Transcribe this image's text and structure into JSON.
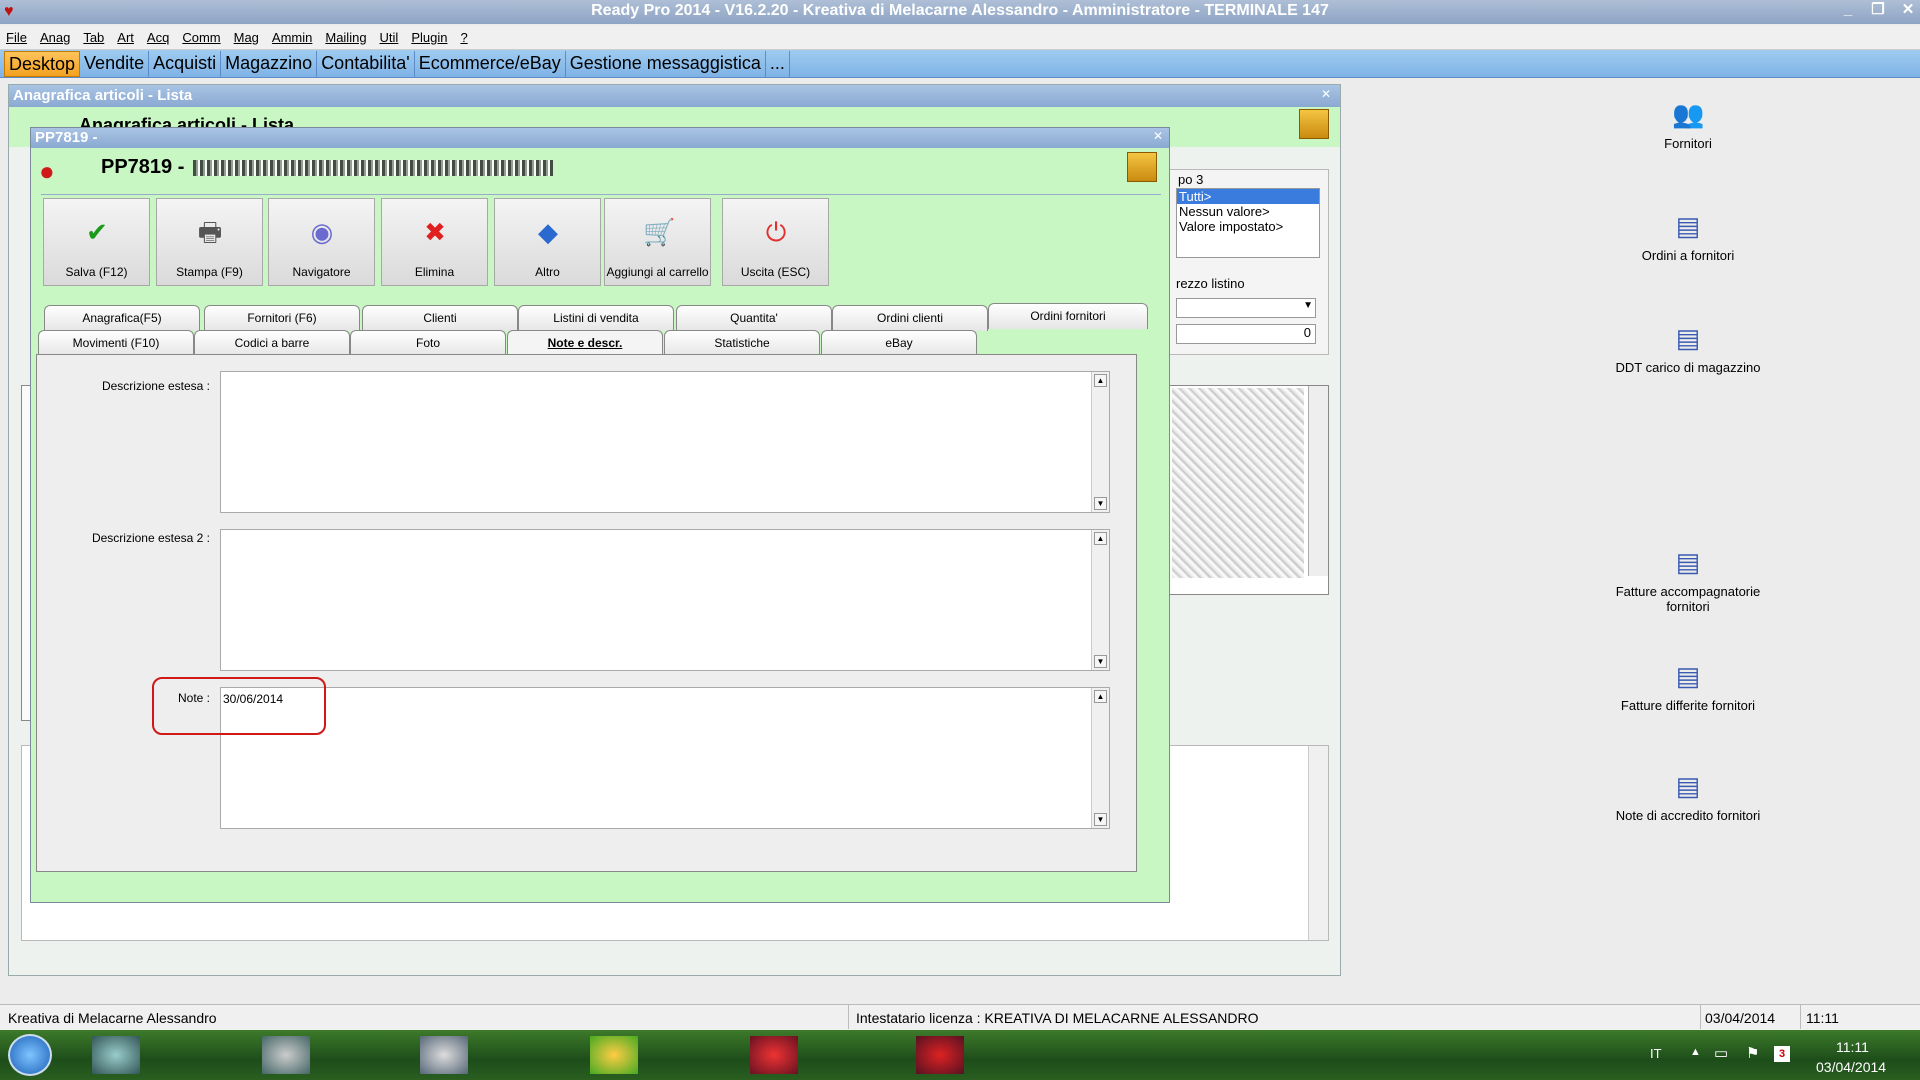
{
  "window": {
    "title": "Ready Pro 2014 - V16.2.20 - Kreativa di Melacarne Alessandro - Amministratore - TERMINALE 147",
    "minimize_icon": "minimize-icon",
    "restore_icon": "restore-icon",
    "close_icon": "close-icon"
  },
  "menu": [
    "File",
    "Anag",
    "Tab",
    "Art",
    "Acq",
    "Comm",
    "Mag",
    "Ammin",
    "Mailing",
    "Util",
    "Plugin",
    "?"
  ],
  "module_tabs": [
    "Desktop",
    "Vendite",
    "Acquisti",
    "Magazzino",
    "Contabilita'",
    "Ecommerce/eBay",
    "Gestione messaggistica",
    "..."
  ],
  "list_window": {
    "title": "Anagrafica articoli  - Lista",
    "subtitle": "Anagrafica articoli  - Lista",
    "filter_label": "po 3",
    "filter_options": [
      "Tutti>",
      "Nessun valore>",
      "Valore impostato>"
    ],
    "price_label": "rezzo listino",
    "price_value": "0"
  },
  "detail": {
    "header": "PP7819 -",
    "title": "PP7819 -",
    "buttons": [
      {
        "label": "Salva (F12)",
        "icon": "check-icon",
        "glyph": "✔",
        "color": "#1a9a1a"
      },
      {
        "label": "Stampa (F9)",
        "icon": "printer-icon",
        "glyph": "🖶",
        "color": "#555"
      },
      {
        "label": "Navigatore",
        "icon": "navigator-icon",
        "glyph": "◉",
        "color": "#6a6ad0"
      },
      {
        "label": "Elimina",
        "icon": "delete-icon",
        "glyph": "✖",
        "color": "#e02020"
      },
      {
        "label": "Altro",
        "icon": "book-icon",
        "glyph": "◆",
        "color": "#2a6ad0"
      },
      {
        "label": "Aggiungi al carrello",
        "icon": "cart-icon",
        "glyph": "🛒",
        "color": "#555"
      },
      {
        "label": "Uscita (ESC)",
        "icon": "exit-icon",
        "glyph": "⏻",
        "color": "#e03030"
      }
    ],
    "tabs_row1": [
      "Anagrafica(F5)",
      "Fornitori (F6)",
      "Clienti",
      "Listini di vendita",
      "Quantita'",
      "Ordini clienti",
      "Ordini fornitori"
    ],
    "tabs_row2": [
      "Movimenti (F10)",
      "Codici a barre",
      "Foto",
      "Note e descr.",
      "Statistiche",
      "eBay"
    ],
    "selected_tab": "Note e descr.",
    "fields": {
      "desc1_label": "Descrizione estesa :",
      "desc1_value": "",
      "desc2_label": "Descrizione estesa 2 :",
      "desc2_value": "",
      "note_label": "Note :",
      "note_value": "30/06/2014"
    }
  },
  "desktop_icons": [
    {
      "label": "Fornitori",
      "icon": "suppliers-icon"
    },
    {
      "label": "Ordini a fornitori",
      "icon": "supplier-orders-icon"
    },
    {
      "label": "DDT carico di magazzino",
      "icon": "ddt-icon"
    },
    {
      "label": "Fatture accompagnatorie fornitori",
      "icon": "invoice-icon"
    },
    {
      "label": "Fatture differite fornitori",
      "icon": "deferred-invoice-icon"
    },
    {
      "label": "Note di accredito fornitori",
      "icon": "credit-note-icon"
    }
  ],
  "status": {
    "company": "Kreativa di Melacarne Alessandro",
    "license": "Intestatario licenza : KREATIVA DI MELACARNE ALESSANDRO",
    "date": "03/04/2014",
    "time": "11:11"
  },
  "taskbar": {
    "lang": "IT",
    "clock_time": "11:11",
    "clock_date": "03/04/2014",
    "badge": "3"
  }
}
